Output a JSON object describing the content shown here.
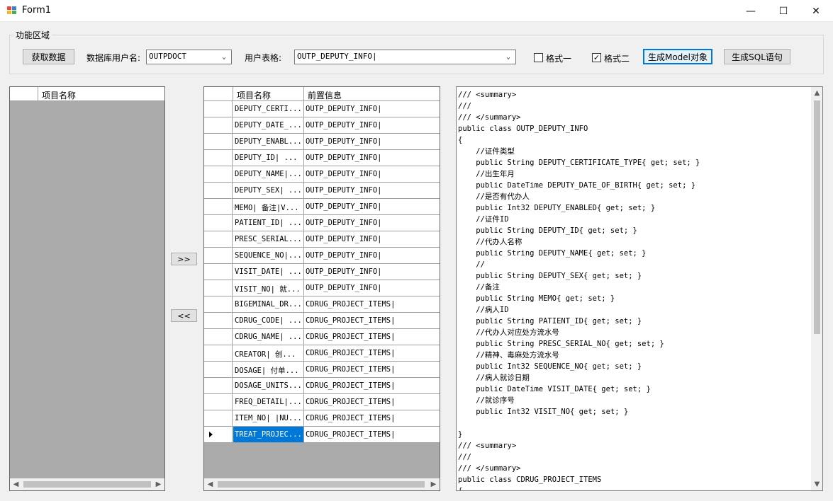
{
  "window": {
    "title": "Form1",
    "minimize": "—",
    "maximize": "☐",
    "close": "✕"
  },
  "group": {
    "title": "功能区域"
  },
  "toolbar": {
    "fetch_label": "获取数据",
    "db_user_label": "数据库用户名:",
    "db_user_value": "OUTPDOCT",
    "table_label": "用户表格:",
    "table_value": "OUTP_DEPUTY_INFO|",
    "format1_label": "格式一",
    "format1_checked": false,
    "format2_label": "格式二",
    "format2_checked": true,
    "gen_model_label": "生成Model对象",
    "gen_sql_label": "生成SQL语句"
  },
  "left_grid": {
    "header": "项目名称"
  },
  "move": {
    "right_label": ">>",
    "left_label": "<<"
  },
  "mid_grid": {
    "headers": [
      "项目名称",
      "前置信息"
    ],
    "rows": [
      {
        "name": "DEPUTY_CERTI...",
        "info": "OUTP_DEPUTY_INFO|"
      },
      {
        "name": "DEPUTY_DATE_...",
        "info": "OUTP_DEPUTY_INFO|"
      },
      {
        "name": "DEPUTY_ENABL...",
        "info": "OUTP_DEPUTY_INFO|"
      },
      {
        "name": "DEPUTY_ID| ...",
        "info": "OUTP_DEPUTY_INFO|"
      },
      {
        "name": "DEPUTY_NAME|...",
        "info": "OUTP_DEPUTY_INFO|"
      },
      {
        "name": "DEPUTY_SEX| ...",
        "info": "OUTP_DEPUTY_INFO|"
      },
      {
        "name": "MEMO| 备注|V...",
        "info": "OUTP_DEPUTY_INFO|"
      },
      {
        "name": "PATIENT_ID| ...",
        "info": "OUTP_DEPUTY_INFO|"
      },
      {
        "name": "PRESC_SERIAL...",
        "info": "OUTP_DEPUTY_INFO|"
      },
      {
        "name": "SEQUENCE_NO|...",
        "info": "OUTP_DEPUTY_INFO|"
      },
      {
        "name": "VISIT_DATE| ...",
        "info": "OUTP_DEPUTY_INFO|"
      },
      {
        "name": "VISIT_NO| 就...",
        "info": "OUTP_DEPUTY_INFO|"
      },
      {
        "name": "BIGEMINAL_DR...",
        "info": "CDRUG_PROJECT_ITEMS|"
      },
      {
        "name": "CDRUG_CODE| ...",
        "info": "CDRUG_PROJECT_ITEMS|"
      },
      {
        "name": "CDRUG_NAME| ...",
        "info": "CDRUG_PROJECT_ITEMS|"
      },
      {
        "name": "CREATOR| 创...",
        "info": "CDRUG_PROJECT_ITEMS|"
      },
      {
        "name": "DOSAGE| 付单...",
        "info": "CDRUG_PROJECT_ITEMS|"
      },
      {
        "name": "DOSAGE_UNITS...",
        "info": "CDRUG_PROJECT_ITEMS|"
      },
      {
        "name": "FREQ_DETAIL|...",
        "info": "CDRUG_PROJECT_ITEMS|"
      },
      {
        "name": "ITEM_NO| |NU...",
        "info": "CDRUG_PROJECT_ITEMS|"
      },
      {
        "name": "TREAT_PROJEC...",
        "info": "CDRUG_PROJECT_ITEMS|"
      }
    ],
    "selected_index": 20
  },
  "code": {
    "lines": [
      "/// <summary>",
      "///",
      "/// </summary>",
      "public class OUTP_DEPUTY_INFO",
      "{",
      "    //证件类型",
      "    public String DEPUTY_CERTIFICATE_TYPE{ get; set; }",
      "    //出生年月",
      "    public DateTime DEPUTY_DATE_OF_BIRTH{ get; set; }",
      "    //是否有代办人",
      "    public Int32 DEPUTY_ENABLED{ get; set; }",
      "    //证件ID",
      "    public String DEPUTY_ID{ get; set; }",
      "    //代办人名称",
      "    public String DEPUTY_NAME{ get; set; }",
      "    //",
      "    public String DEPUTY_SEX{ get; set; }",
      "    //备注",
      "    public String MEMO{ get; set; }",
      "    //病人ID",
      "    public String PATIENT_ID{ get; set; }",
      "    //代办人对应处方流水号",
      "    public String PRESC_SERIAL_NO{ get; set; }",
      "    //精神、毒麻处方流水号",
      "    public Int32 SEQUENCE_NO{ get; set; }",
      "    //病人就诊日期",
      "    public DateTime VISIT_DATE{ get; set; }",
      "    //就诊序号",
      "    public Int32 VISIT_NO{ get; set; }",
      "",
      "}",
      "/// <summary>",
      "///",
      "/// </summary>",
      "public class CDRUG_PROJECT_ITEMS",
      "{"
    ]
  }
}
